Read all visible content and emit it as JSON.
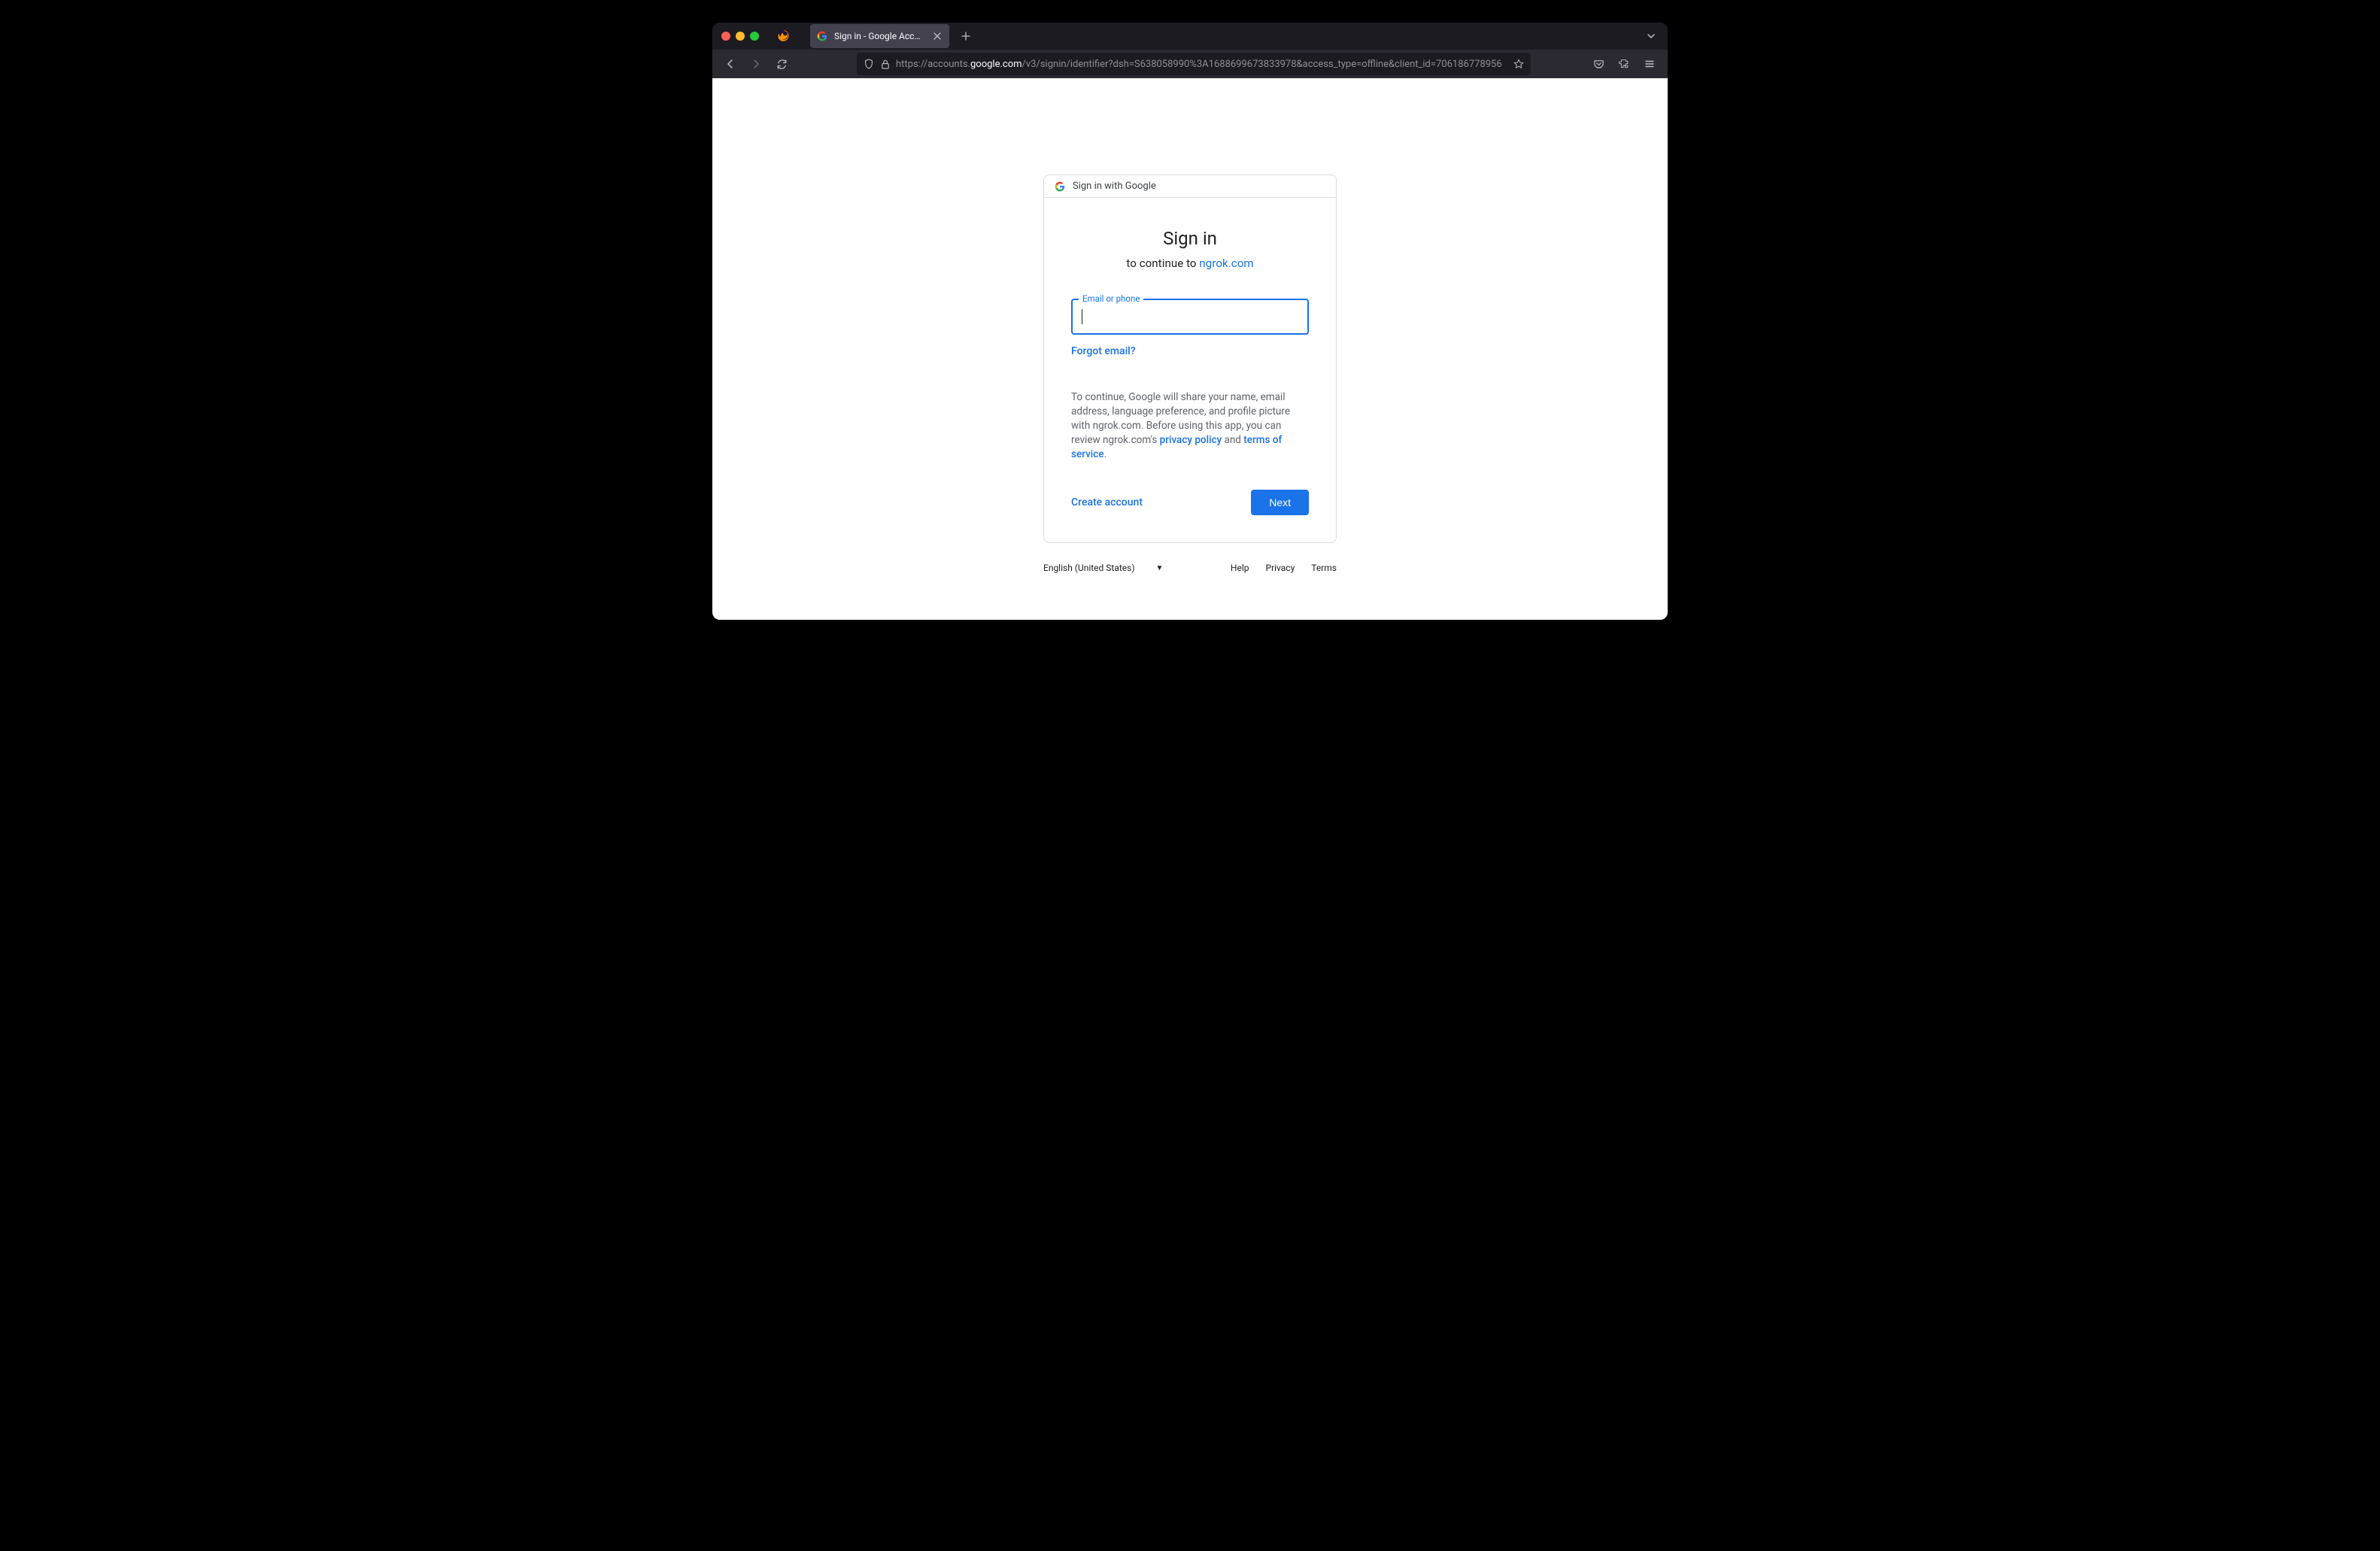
{
  "browser": {
    "tab_title": "Sign in - Google Accounts",
    "url_protocol": "https://",
    "url_subdomain": "accounts.",
    "url_domain": "google.com",
    "url_path": "/v3/signin/identifier?dsh=S638058990%3A1688699673833978&access_type=offline&client_id=706186778956"
  },
  "card": {
    "header_text": "Sign in with Google",
    "title": "Sign in",
    "subtitle_prefix": "to continue to ",
    "subtitle_link": "ngrok.com",
    "input_label": "Email or phone",
    "input_value": "",
    "forgot_link": "Forgot email?",
    "disclosure_prefix": "To continue, Google will share your name, email address, language preference, and profile picture with ngrok.com. Before using this app, you can review ngrok.com's ",
    "disclosure_pp": "privacy policy",
    "disclosure_and": " and ",
    "disclosure_tos": "terms of service",
    "disclosure_period": ".",
    "create_account": "Create account",
    "next": "Next"
  },
  "footer": {
    "language": "English (United States)",
    "links": [
      "Help",
      "Privacy",
      "Terms"
    ]
  }
}
